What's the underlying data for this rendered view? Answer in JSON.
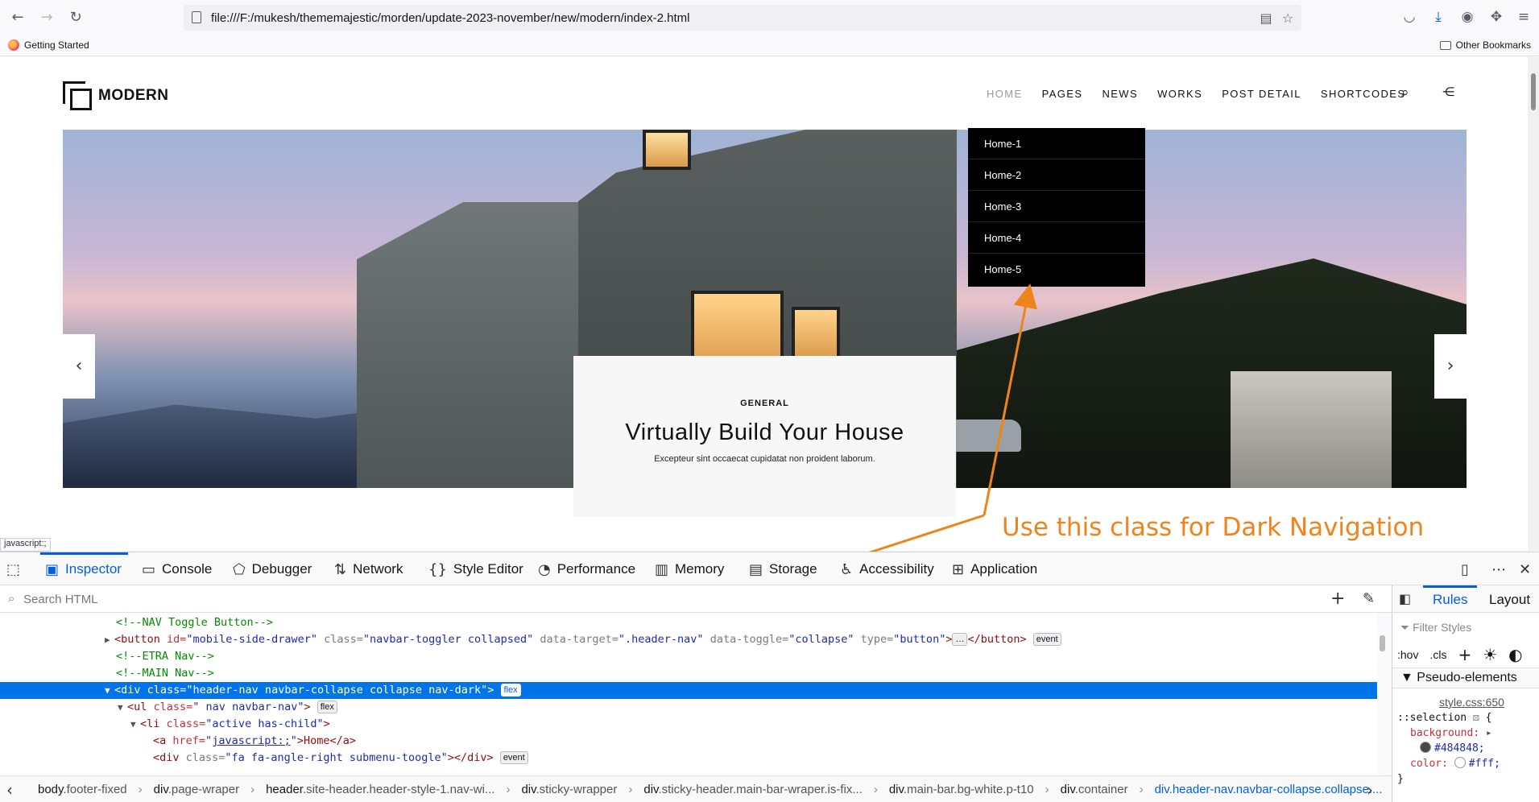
{
  "browser": {
    "url": "file:///F:/mukesh/thememajestic/morden/update-2023-november/new/modern/index-2.html",
    "bookmark_getting_started": "Getting Started",
    "bookmark_other": "Other Bookmarks",
    "status_url": "javascript:;"
  },
  "site": {
    "logo_text": "MODERN",
    "nav": [
      "HOME",
      "PAGES",
      "NEWS",
      "WORKS",
      "POST DETAIL",
      "SHORTCODES"
    ],
    "dropdown": [
      "Home-1",
      "Home-2",
      "Home-3",
      "Home-4",
      "Home-5"
    ],
    "caption": {
      "kicker": "GENERAL",
      "headline": "Virtually Build Your House",
      "sub": "Excepteur sint occaecat cupidatat non proident laborum."
    },
    "prev_arrow": "‹",
    "next_arrow": "›"
  },
  "annotation": {
    "text": "Use this class for Dark Navigation",
    "color": "#f0841c"
  },
  "devtools": {
    "tabs": [
      "Inspector",
      "Console",
      "Debugger",
      "Network",
      "Style Editor",
      "Performance",
      "Memory",
      "Storage",
      "Accessibility",
      "Application"
    ],
    "active_tab": "Inspector",
    "search_placeholder": "Search HTML",
    "html": {
      "line1": "<!--NAV Toggle Button-->",
      "line2": {
        "tag_open": "<button",
        "id_attr": " id=",
        "id_val": "\"mobile-side-drawer\"",
        "class_attr": " class=",
        "class_val": "\"navbar-toggler collapsed\"",
        "dt_attr": " data-target=",
        "dt_val": "\".header-nav\"",
        "dtg_attr": " data-toggle=",
        "dtg_val": "\"collapse\"",
        "type_attr": " type=",
        "type_val": "\"button\"",
        "close": "</button>",
        "badge": "event"
      },
      "line3": "<!--ETRA Nav-->",
      "line4": "<!--MAIN Nav-->",
      "line5": {
        "text": "<div class=\"header-nav navbar-collapse collapse nav-dark\">",
        "badge": "flex"
      },
      "line6": {
        "tag": "<ul",
        "class_attr": " class=",
        "class_val": "\" nav navbar-nav\"",
        "end": ">",
        "badge": "flex"
      },
      "line7": {
        "tag": "<li",
        "class_attr": " class=",
        "class_val": "\"active has-child\"",
        "end": ">"
      },
      "line8": {
        "tag": "<a",
        "href_attr": " href=",
        "href_q1": "\"",
        "href_val": "javascript:;",
        "href_q2": "\"",
        "rest": ">Home</a>"
      },
      "line9": {
        "tag": "<div",
        "class_attr": " class=",
        "class_val": "\"fa fa-angle-right submenu-toogle\"",
        "rest": "></div>",
        "badge": "event"
      }
    },
    "breadcrumbs": [
      {
        "tag": "body",
        "rest": ".footer-fixed"
      },
      {
        "tag": "div",
        "rest": ".page-wraper"
      },
      {
        "tag": "header",
        "rest": ".site-header.header-style-1.nav-wi..."
      },
      {
        "tag": "div",
        "rest": ".sticky-wrapper"
      },
      {
        "tag": "div",
        "rest": ".sticky-header.main-bar-wraper.is-fix..."
      },
      {
        "tag": "div",
        "rest": ".main-bar.bg-white.p-t10"
      },
      {
        "tag": "div",
        "rest": ".container"
      },
      {
        "tag": "div",
        "rest": ".header-nav.navbar-collapse.collapse...."
      }
    ],
    "rules": {
      "tab_rules": "Rules",
      "tab_layout": "Layout",
      "filter_placeholder": "Filter Styles",
      "hov": ":hov",
      "cls": ".cls",
      "pseudo_header": "Pseudo-elements",
      "source": "style.css:650",
      "selector": "::selection",
      "brace_open": "{",
      "prop1": "background:",
      "val1": "#484848;",
      "prop2": "color:",
      "val2": "#fff;",
      "brace_close": "}",
      "swatch1": "#484848",
      "swatch2": "#ffffff"
    }
  }
}
